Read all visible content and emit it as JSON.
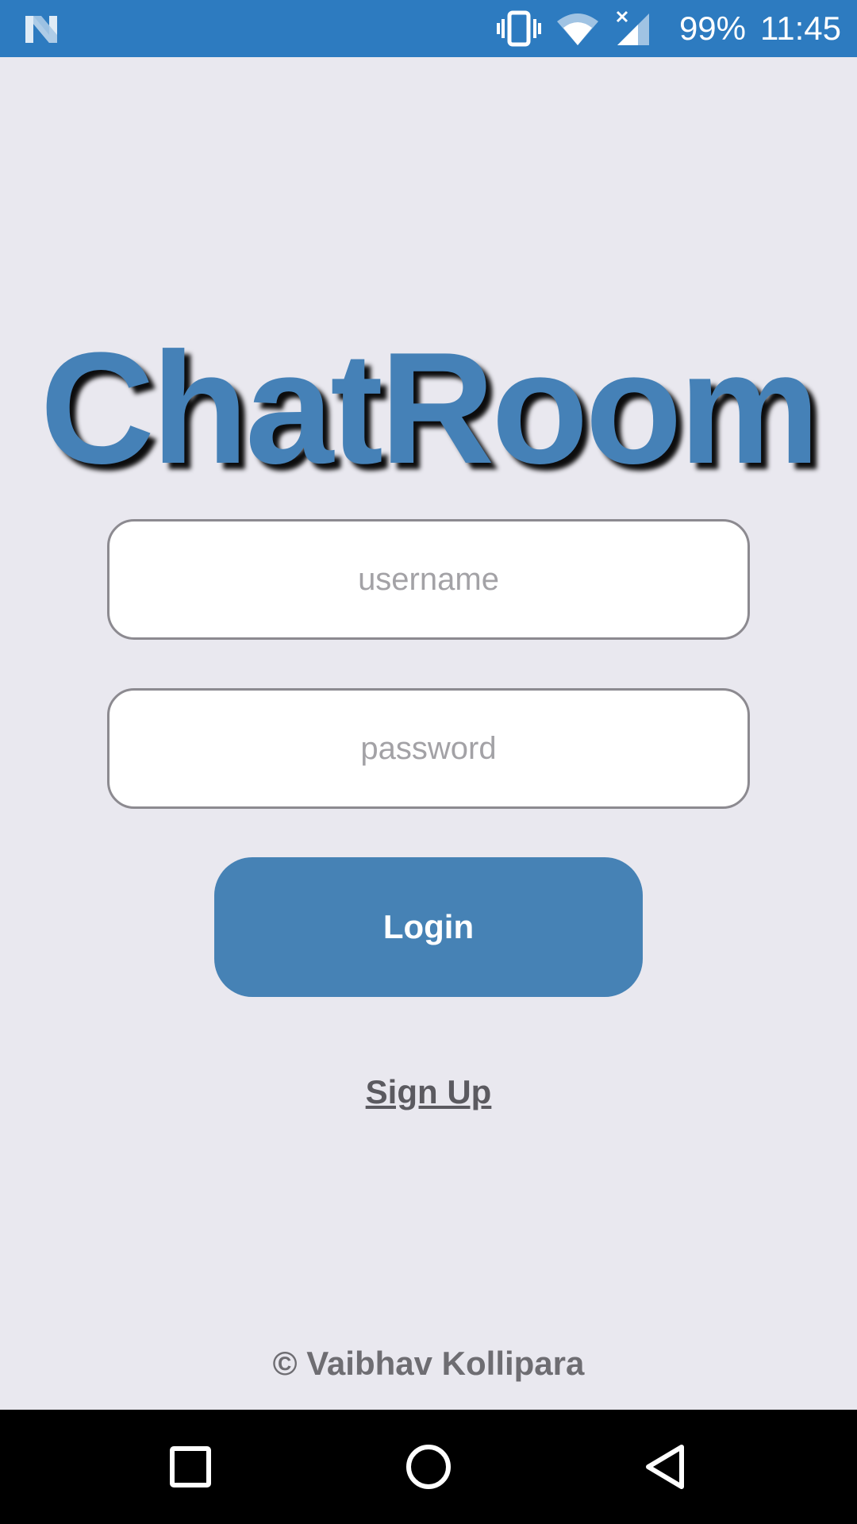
{
  "status_bar": {
    "app_icon": "n-notification-icon",
    "icons": [
      "vibrate-icon",
      "wifi-icon",
      "signal-icon"
    ],
    "battery": "99%",
    "time": "11:45",
    "background_color": "#2d7bc0"
  },
  "app": {
    "title": "ChatRoom",
    "title_color": "#4581b7",
    "background_color": "#e9e8ef"
  },
  "form": {
    "username_placeholder": "username",
    "username_value": "",
    "password_placeholder": "password",
    "password_value": "",
    "login_label": "Login",
    "login_color": "#4682b5",
    "signup_label": "Sign Up"
  },
  "footer": {
    "copyright": "© Vaibhav Kollipara"
  },
  "nav_bar": {
    "buttons": [
      "recents-icon",
      "home-icon",
      "back-icon"
    ]
  }
}
